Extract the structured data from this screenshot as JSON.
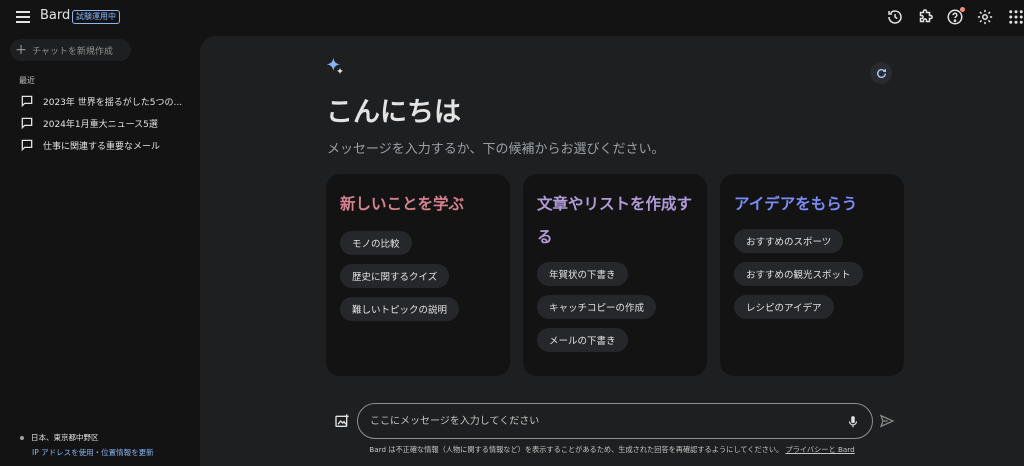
{
  "app": {
    "name": "Bard",
    "badge": "試験運用中"
  },
  "topbar": {
    "icons": [
      "history-icon",
      "extensions-icon",
      "help-icon",
      "settings-icon",
      "apps-grid-icon"
    ]
  },
  "sidebar": {
    "new_chat": "チャットを新規作成",
    "recent_label": "最近",
    "chats": [
      {
        "title": "2023年 世界を揺るがした5つの..."
      },
      {
        "title": "2024年1月重大ニュース5選"
      },
      {
        "title": "仕事に関連する重要なメール"
      }
    ],
    "location": "日本、東京都中野区",
    "location_links": "IP アドレスを使用・位置情報を更新"
  },
  "main": {
    "greeting": "こんにちは",
    "subtitle": "メッセージを入力するか、下の候補からお選びください。",
    "cards": [
      {
        "title": "新しいことを学ぶ",
        "color": "#d7838f",
        "chips": [
          "モノの比較",
          "歴史に関するクイズ",
          "難しいトピックの説明"
        ]
      },
      {
        "title": "文章やリストを作成する",
        "color": "#b19cd9",
        "chips": [
          "年賀状の下書き",
          "キャッチコピーの作成",
          "メールの下書き"
        ]
      },
      {
        "title": "アイデアをもらう",
        "color": "#7b8cf7",
        "chips": [
          "おすすめのスポーツ",
          "おすすめの観光スポット",
          "レシピのアイデア"
        ]
      }
    ],
    "input_placeholder": "ここにメッセージを入力してください",
    "disclaimer_text": "Bard は不正確な情報（人物に関する情報など）を表示することがあるため、生成された回答を再確認するようにしてください。",
    "disclaimer_link": "プライバシーと Bard"
  }
}
